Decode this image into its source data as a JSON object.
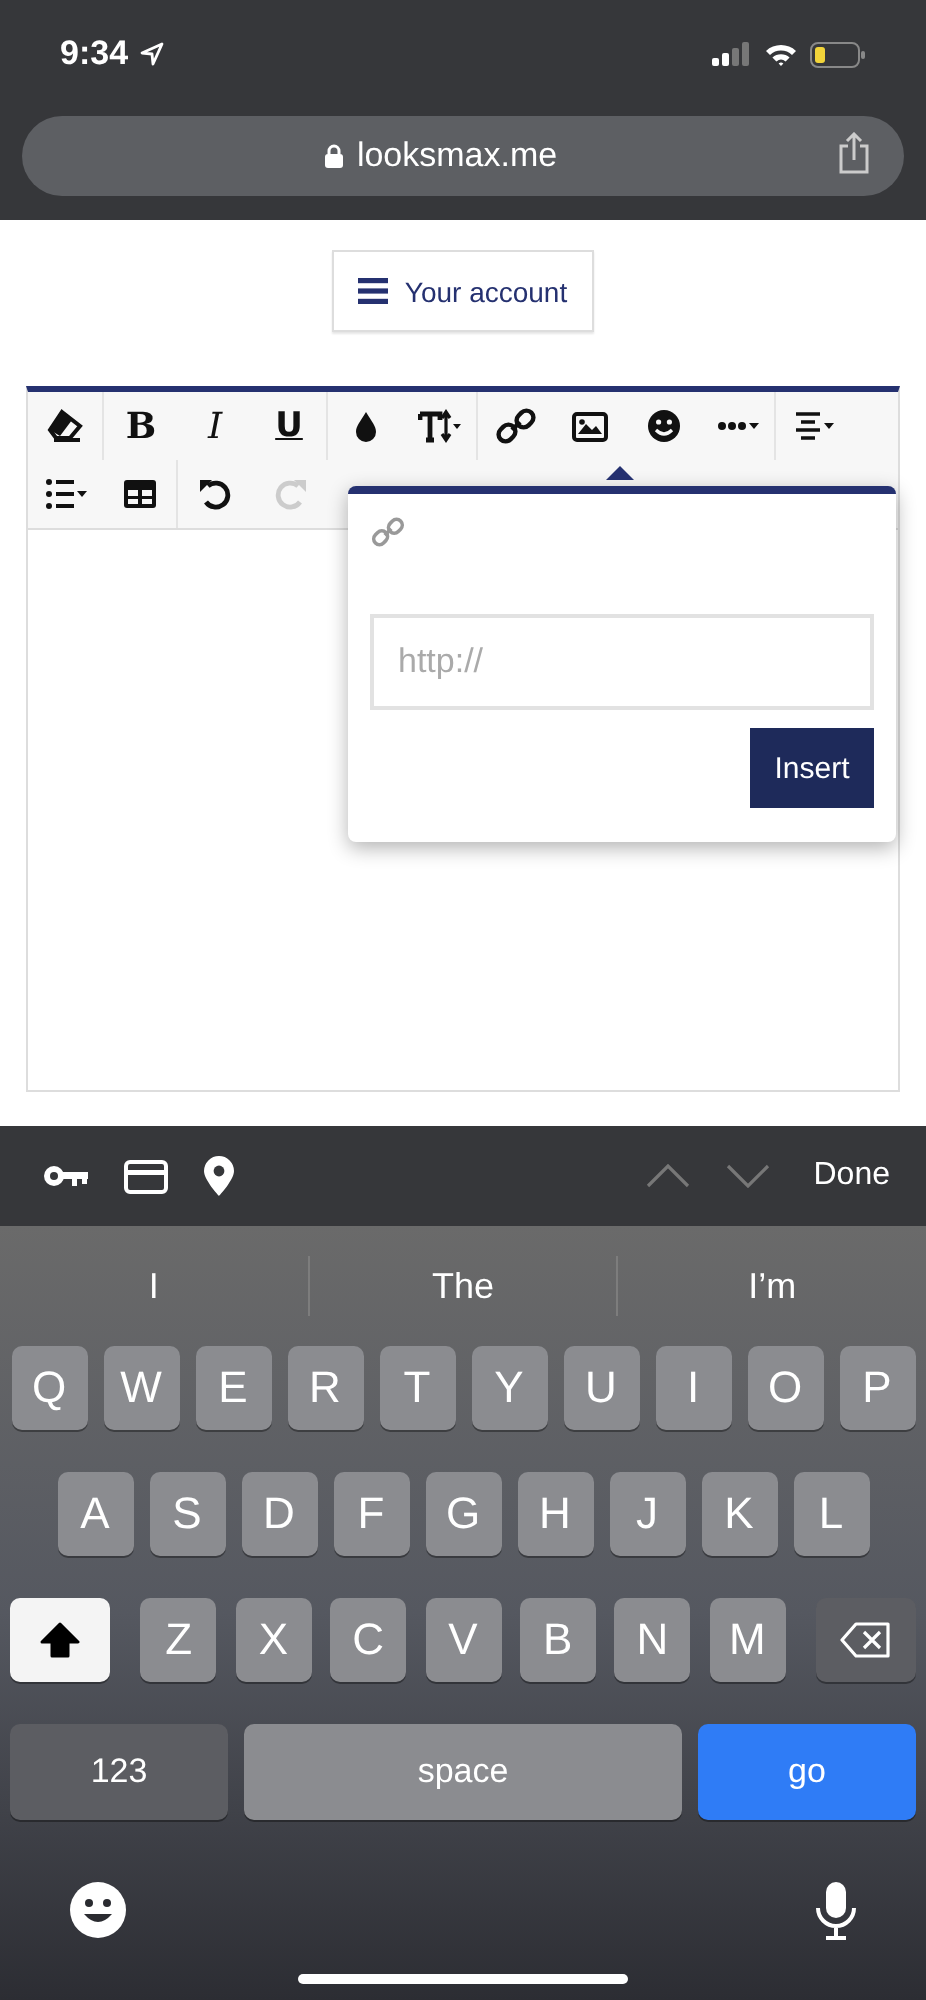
{
  "status_bar": {
    "time": "9:34"
  },
  "address_bar": {
    "url": "looksmax.me"
  },
  "account_button": {
    "label": "Your account"
  },
  "editor": {
    "toolbar": [
      [
        {
          "kind": "eraser",
          "disabled": false
        }
      ],
      [
        {
          "kind": "bold",
          "label": "B",
          "disabled": false
        },
        {
          "kind": "italic",
          "label": "I",
          "disabled": false
        },
        {
          "kind": "underline",
          "label": "U",
          "disabled": false
        }
      ],
      [
        {
          "kind": "drop",
          "disabled": false
        },
        {
          "kind": "textsize",
          "disabled": false
        }
      ],
      [
        {
          "kind": "link",
          "disabled": false
        },
        {
          "kind": "image",
          "disabled": false
        },
        {
          "kind": "smile",
          "disabled": false
        },
        {
          "kind": "more",
          "disabled": false
        }
      ],
      [
        {
          "kind": "align",
          "disabled": false
        }
      ],
      [
        {
          "kind": "list",
          "disabled": false
        },
        {
          "kind": "table",
          "disabled": false
        }
      ],
      [
        {
          "kind": "undo",
          "disabled": false
        },
        {
          "kind": "redo",
          "disabled": true
        }
      ]
    ],
    "popup": {
      "placeholder": "http://",
      "button": "Insert"
    }
  },
  "accessory_bar": {
    "done": "Done"
  },
  "suggestions": [
    "I",
    "The",
    "I’m"
  ],
  "keyboard": {
    "letter_rows": [
      [
        {
          "kind": "letter",
          "label": "Q"
        },
        {
          "kind": "letter",
          "label": "W"
        },
        {
          "kind": "letter",
          "label": "E"
        },
        {
          "kind": "letter",
          "label": "R"
        },
        {
          "kind": "letter",
          "label": "T"
        },
        {
          "kind": "letter",
          "label": "Y"
        },
        {
          "kind": "letter",
          "label": "U"
        },
        {
          "kind": "letter",
          "label": "I"
        },
        {
          "kind": "letter",
          "label": "O"
        },
        {
          "kind": "letter",
          "label": "P"
        }
      ],
      [
        {
          "kind": "letter",
          "label": "A"
        },
        {
          "kind": "letter",
          "label": "S"
        },
        {
          "kind": "letter",
          "label": "D"
        },
        {
          "kind": "letter",
          "label": "F"
        },
        {
          "kind": "letter",
          "label": "G"
        },
        {
          "kind": "letter",
          "label": "H"
        },
        {
          "kind": "letter",
          "label": "J"
        },
        {
          "kind": "letter",
          "label": "K"
        },
        {
          "kind": "letter",
          "label": "L"
        }
      ],
      [
        {
          "kind": "shift",
          "on": true
        },
        {
          "kind": "letter",
          "label": "Z"
        },
        {
          "kind": "letter",
          "label": "X"
        },
        {
          "kind": "letter",
          "label": "C"
        },
        {
          "kind": "letter",
          "label": "V"
        },
        {
          "kind": "letter",
          "label": "B"
        },
        {
          "kind": "letter",
          "label": "N"
        },
        {
          "kind": "letter",
          "label": "M"
        },
        {
          "kind": "backspace"
        }
      ]
    ],
    "bottom_keys": [
      {
        "kind": "mode",
        "label": "123"
      },
      {
        "kind": "space",
        "label": "space"
      },
      {
        "kind": "go",
        "label": "go"
      }
    ]
  }
}
